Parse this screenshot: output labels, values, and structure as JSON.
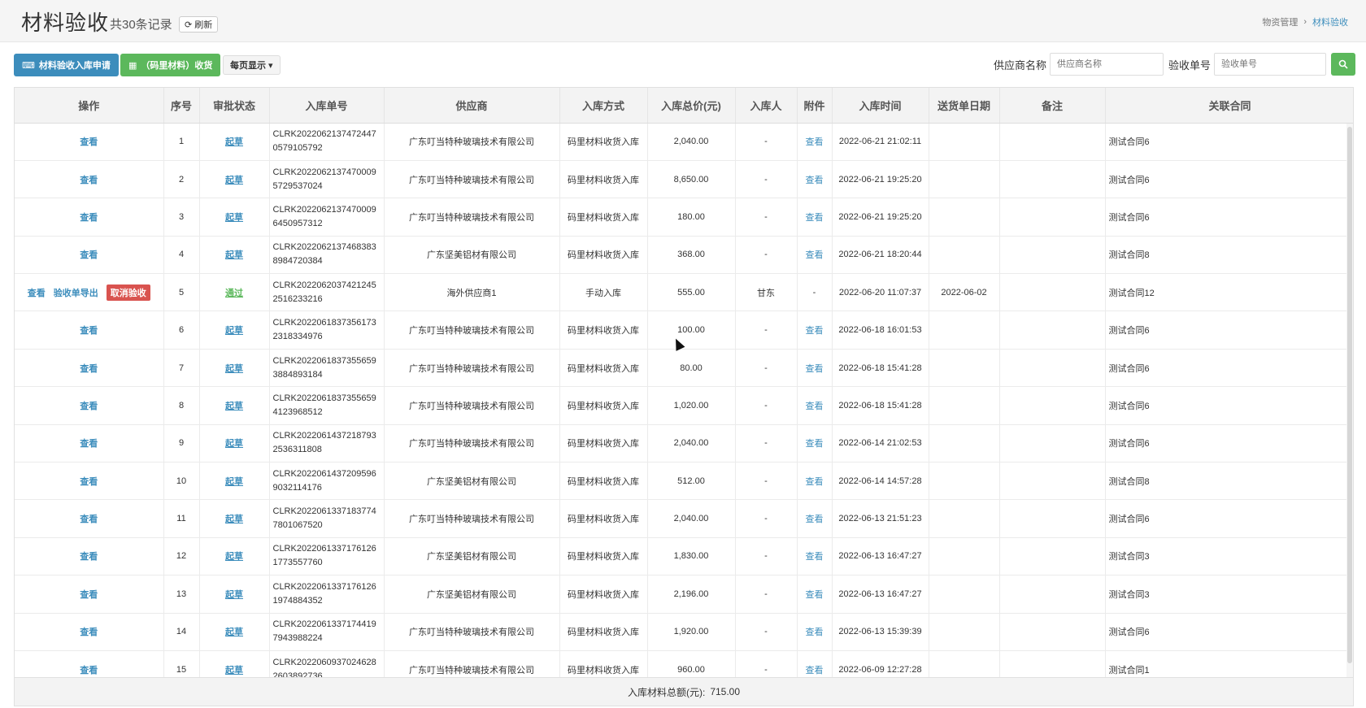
{
  "header": {
    "title": "材料验收",
    "record_count": "共30条记录",
    "refresh_label": "刷新",
    "breadcrumb": [
      "物资管理",
      "材料验收"
    ]
  },
  "toolbar": {
    "apply_label": "材料验收入库申请",
    "receive_label": "（码里材料）收货",
    "per_page_label": "每页显示"
  },
  "search": {
    "supplier_label": "供应商名称",
    "supplier_placeholder": "供应商名称",
    "order_label": "验收单号",
    "order_placeholder": "验收单号"
  },
  "table": {
    "columns": [
      "操作",
      "序号",
      "审批状态",
      "入库单号",
      "供应商",
      "入库方式",
      "入库总价(元)",
      "入库人",
      "附件",
      "入库时间",
      "送货单日期",
      "备注",
      "关联合同"
    ],
    "rows": [
      {
        "action": "查看",
        "seq": "1",
        "status": "起草",
        "order_no": "CLRK20220621374724470579105792",
        "supplier": "广东叮当特种玻璃技术有限公司",
        "method": "码里材料收货入库",
        "total": "2,040.00",
        "person": "-",
        "attachment": "查看",
        "time": "2022-06-21 21:02:11",
        "delivery_date": "",
        "remark": "",
        "contract": "测试合同6"
      },
      {
        "action": "查看",
        "seq": "2",
        "status": "起草",
        "order_no": "CLRK20220621374700095729537024",
        "supplier": "广东叮当特种玻璃技术有限公司",
        "method": "码里材料收货入库",
        "total": "8,650.00",
        "person": "-",
        "attachment": "查看",
        "time": "2022-06-21 19:25:20",
        "delivery_date": "",
        "remark": "",
        "contract": "测试合同6"
      },
      {
        "action": "查看",
        "seq": "3",
        "status": "起草",
        "order_no": "CLRK20220621374700096450957312",
        "supplier": "广东叮当特种玻璃技术有限公司",
        "method": "码里材料收货入库",
        "total": "180.00",
        "person": "-",
        "attachment": "查看",
        "time": "2022-06-21 19:25:20",
        "delivery_date": "",
        "remark": "",
        "contract": "测试合同6"
      },
      {
        "action": "查看",
        "seq": "4",
        "status": "起草",
        "order_no": "CLRK20220621374683838984720384",
        "supplier": "广东坚美铝材有限公司",
        "method": "码里材料收货入库",
        "total": "368.00",
        "person": "-",
        "attachment": "查看",
        "time": "2022-06-21 18:20:44",
        "delivery_date": "",
        "remark": "",
        "contract": "测试合同8"
      },
      {
        "action": "查看",
        "action2": "验收单导出",
        "action3": "取消验收",
        "seq": "5",
        "status": "通过",
        "order_no": "CLRK20220620374212452516233216",
        "supplier": "海外供应商1",
        "method": "手动入库",
        "total": "555.00",
        "person": "甘东",
        "attachment": "-",
        "time": "2022-06-20 11:07:37",
        "delivery_date": "2022-06-02",
        "remark": "",
        "contract": "测试合同12"
      },
      {
        "action": "查看",
        "seq": "6",
        "status": "起草",
        "order_no": "CLRK20220618373561732318334976",
        "supplier": "广东叮当特种玻璃技术有限公司",
        "method": "码里材料收货入库",
        "total": "100.00",
        "person": "-",
        "attachment": "查看",
        "time": "2022-06-18 16:01:53",
        "delivery_date": "",
        "remark": "",
        "contract": "测试合同6"
      },
      {
        "action": "查看",
        "seq": "7",
        "status": "起草",
        "order_no": "CLRK20220618373556593884893184",
        "supplier": "广东叮当特种玻璃技术有限公司",
        "method": "码里材料收货入库",
        "total": "80.00",
        "person": "-",
        "attachment": "查看",
        "time": "2022-06-18 15:41:28",
        "delivery_date": "",
        "remark": "",
        "contract": "测试合同6"
      },
      {
        "action": "查看",
        "seq": "8",
        "status": "起草",
        "order_no": "CLRK20220618373556594123968512",
        "supplier": "广东叮当特种玻璃技术有限公司",
        "method": "码里材料收货入库",
        "total": "1,020.00",
        "person": "-",
        "attachment": "查看",
        "time": "2022-06-18 15:41:28",
        "delivery_date": "",
        "remark": "",
        "contract": "测试合同6"
      },
      {
        "action": "查看",
        "seq": "9",
        "status": "起草",
        "order_no": "CLRK20220614372187932536311808",
        "supplier": "广东叮当特种玻璃技术有限公司",
        "method": "码里材料收货入库",
        "total": "2,040.00",
        "person": "-",
        "attachment": "查看",
        "time": "2022-06-14 21:02:53",
        "delivery_date": "",
        "remark": "",
        "contract": "测试合同6"
      },
      {
        "action": "查看",
        "seq": "10",
        "status": "起草",
        "order_no": "CLRK20220614372095969032114176",
        "supplier": "广东坚美铝材有限公司",
        "method": "码里材料收货入库",
        "total": "512.00",
        "person": "-",
        "attachment": "查看",
        "time": "2022-06-14 14:57:28",
        "delivery_date": "",
        "remark": "",
        "contract": "测试合同8"
      },
      {
        "action": "查看",
        "seq": "11",
        "status": "起草",
        "order_no": "CLRK20220613371837747801067520",
        "supplier": "广东叮当特种玻璃技术有限公司",
        "method": "码里材料收货入库",
        "total": "2,040.00",
        "person": "-",
        "attachment": "查看",
        "time": "2022-06-13 21:51:23",
        "delivery_date": "",
        "remark": "",
        "contract": "测试合同6"
      },
      {
        "action": "查看",
        "seq": "12",
        "status": "起草",
        "order_no": "CLRK20220613371761261773557760",
        "supplier": "广东坚美铝材有限公司",
        "method": "码里材料收货入库",
        "total": "1,830.00",
        "person": "-",
        "attachment": "查看",
        "time": "2022-06-13 16:47:27",
        "delivery_date": "",
        "remark": "",
        "contract": "测试合同3"
      },
      {
        "action": "查看",
        "seq": "13",
        "status": "起草",
        "order_no": "CLRK20220613371761261974884352",
        "supplier": "广东坚美铝材有限公司",
        "method": "码里材料收货入库",
        "total": "2,196.00",
        "person": "-",
        "attachment": "查看",
        "time": "2022-06-13 16:47:27",
        "delivery_date": "",
        "remark": "",
        "contract": "测试合同3"
      },
      {
        "action": "查看",
        "seq": "14",
        "status": "起草",
        "order_no": "CLRK20220613371744197943988224",
        "supplier": "广东叮当特种玻璃技术有限公司",
        "method": "码里材料收货入库",
        "total": "1,920.00",
        "person": "-",
        "attachment": "查看",
        "time": "2022-06-13 15:39:39",
        "delivery_date": "",
        "remark": "",
        "contract": "测试合同6"
      },
      {
        "action": "查看",
        "seq": "15",
        "status": "起草",
        "order_no": "CLRK20220609370246282603892736",
        "supplier": "广东叮当特种玻璃技术有限公司",
        "method": "码里材料收货入库",
        "total": "960.00",
        "person": "-",
        "attachment": "查看",
        "time": "2022-06-09 12:27:28",
        "delivery_date": "",
        "remark": "",
        "contract": "测试合同1"
      }
    ]
  },
  "footer": {
    "total_label": "入库材料总额(元):",
    "total_value": "715.00"
  },
  "colors": {
    "primary": "#3c8dbc",
    "success": "#5cb85c",
    "danger": "#d9534f"
  }
}
